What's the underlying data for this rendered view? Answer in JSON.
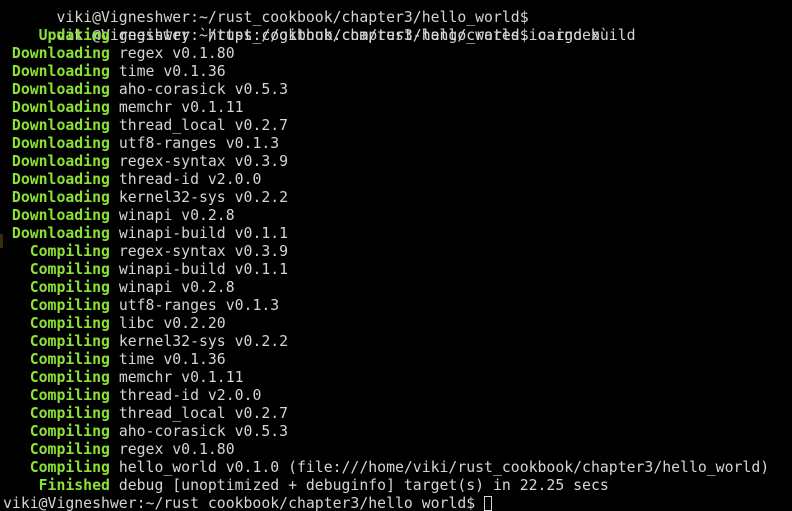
{
  "terminal": {
    "top_line": "viki@Vigneshwer:~/rust_cookbook/chapter3/hello_world$",
    "prompt": "viki@Vigneshwer:~/rust_cookbook/chapter3/hello_world$",
    "command": " cargo build",
    "status_color": "#8ae234",
    "text_color": "#d3d7cf",
    "background_color": "#000000",
    "output": [
      {
        "status": "    Updating",
        "text": " registry `https://github.com/rust-lang/crates.io-index`"
      },
      {
        "status": " Downloading",
        "text": " regex v0.1.80"
      },
      {
        "status": " Downloading",
        "text": " time v0.1.36"
      },
      {
        "status": " Downloading",
        "text": " aho-corasick v0.5.3"
      },
      {
        "status": " Downloading",
        "text": " memchr v0.1.11"
      },
      {
        "status": " Downloading",
        "text": " thread_local v0.2.7"
      },
      {
        "status": " Downloading",
        "text": " utf8-ranges v0.1.3"
      },
      {
        "status": " Downloading",
        "text": " regex-syntax v0.3.9"
      },
      {
        "status": " Downloading",
        "text": " thread-id v2.0.0"
      },
      {
        "status": " Downloading",
        "text": " kernel32-sys v0.2.2"
      },
      {
        "status": " Downloading",
        "text": " winapi v0.2.8"
      },
      {
        "status": " Downloading",
        "text": " winapi-build v0.1.1"
      },
      {
        "status": "   Compiling",
        "text": " regex-syntax v0.3.9"
      },
      {
        "status": "   Compiling",
        "text": " winapi-build v0.1.1"
      },
      {
        "status": "   Compiling",
        "text": " winapi v0.2.8"
      },
      {
        "status": "   Compiling",
        "text": " utf8-ranges v0.1.3"
      },
      {
        "status": "   Compiling",
        "text": " libc v0.2.20"
      },
      {
        "status": "   Compiling",
        "text": " kernel32-sys v0.2.2"
      },
      {
        "status": "   Compiling",
        "text": " time v0.1.36"
      },
      {
        "status": "   Compiling",
        "text": " memchr v0.1.11"
      },
      {
        "status": "   Compiling",
        "text": " thread-id v2.0.0"
      },
      {
        "status": "   Compiling",
        "text": " thread_local v0.2.7"
      },
      {
        "status": "   Compiling",
        "text": " aho-corasick v0.5.3"
      },
      {
        "status": "   Compiling",
        "text": " regex v0.1.80"
      },
      {
        "status": "   Compiling",
        "text": " hello_world v0.1.0 (file:///home/viki/rust_cookbook/chapter3/hello_world)"
      },
      {
        "status": "    Finished",
        "text": " debug [unoptimized + debuginfo] target(s) in 22.25 secs"
      }
    ],
    "final_prompt": "viki@Vigneshwer:~/rust_cookbook/chapter3/hello_world$ "
  }
}
